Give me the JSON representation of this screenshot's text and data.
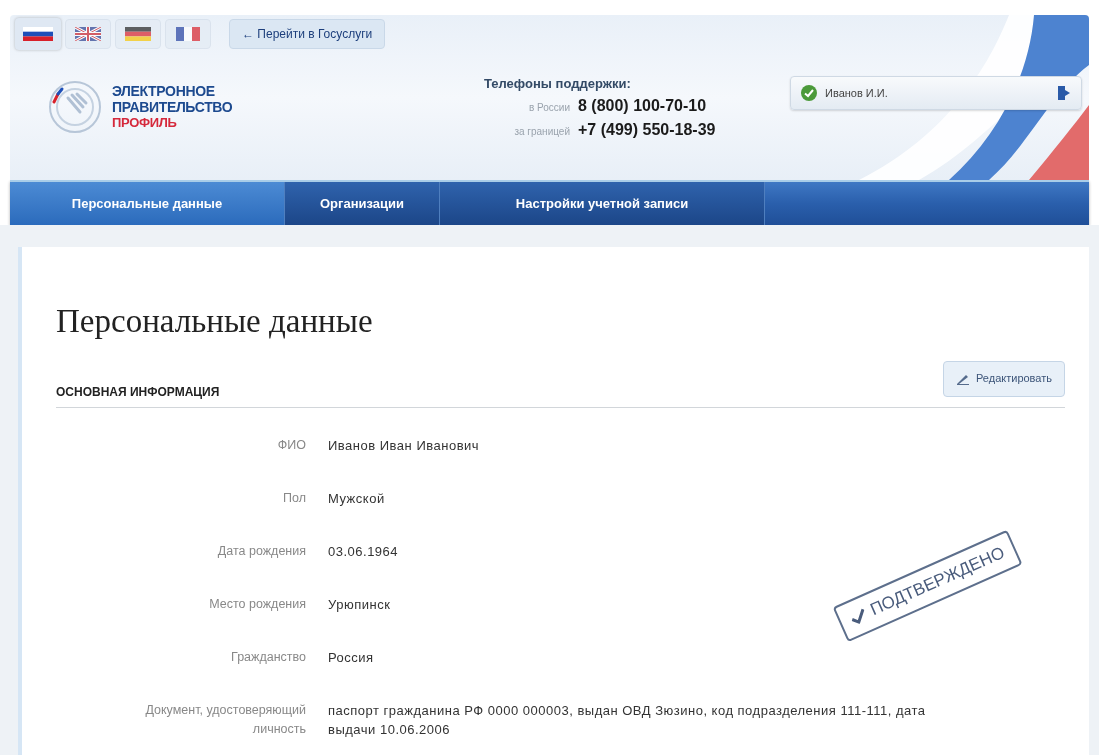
{
  "languages": [
    {
      "kind": "ru",
      "selected": true
    },
    {
      "kind": "gb",
      "selected": false
    },
    {
      "kind": "de",
      "selected": false
    },
    {
      "kind": "fr",
      "selected": false
    }
  ],
  "portal_link": "← Перейти в Госуслуги",
  "logo": {
    "line_1": "ЭЛЕКТРОННОЕ",
    "line_2": "ПРАВИТЕЛЬСТВО",
    "line_3": "ПРОФИЛЬ"
  },
  "support": {
    "title": "Телефоны поддержки:",
    "lines": [
      {
        "label": "в России",
        "phone": "8 (800) 100-70-10"
      },
      {
        "label": "за границей",
        "phone": "+7 (499) 550-18-39"
      }
    ]
  },
  "user": {
    "name": "Иванов И.И.",
    "verified": true
  },
  "tabs": [
    {
      "label": "Персональные данные",
      "selected": true
    },
    {
      "label": "Организации",
      "selected": false
    },
    {
      "label": "Настройки учетной записи",
      "selected": false
    }
  ],
  "page_title": "Персональные данные",
  "section": {
    "title": "ОСНОВНАЯ ИНФОРМАЦИЯ",
    "edit_button": "Редактировать"
  },
  "fields": [
    {
      "label": "ФИО",
      "value": "Иванов Иван Иванович"
    },
    {
      "label": "Пол",
      "value": "Мужской"
    },
    {
      "label": "Дата рождения",
      "value": "03.06.1964"
    },
    {
      "label": "Место рождения",
      "value": "Урюпинск"
    },
    {
      "label": "Гражданство",
      "value": "Россия"
    },
    {
      "label": "Документ, удостоверяющий личность",
      "value": "паспорт гражданина РФ 0000 000003, выдан ОВД Зюзино, код подразделения 111-111, дата выдачи 10.06.2006"
    }
  ],
  "stamp": "ПОДТВЕРЖДЕНО"
}
